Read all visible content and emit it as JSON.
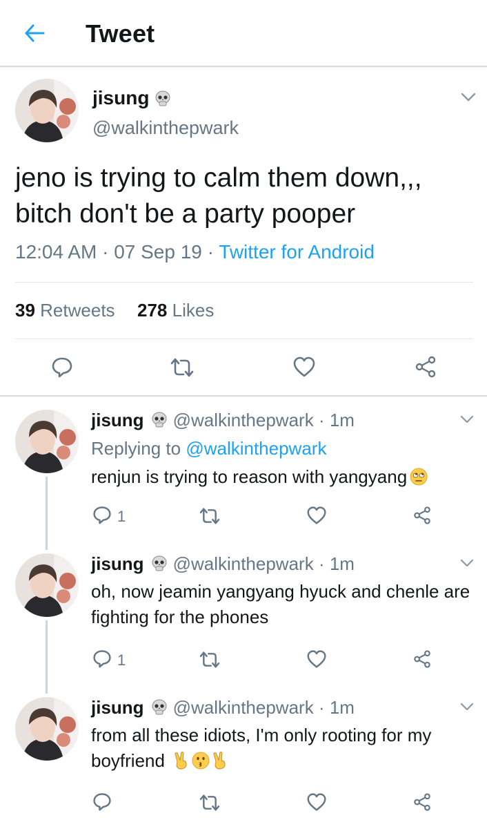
{
  "header": {
    "title": "Tweet"
  },
  "main_tweet": {
    "name": "jisung",
    "handle": "@walkinthepwark",
    "text": "jeno is trying to calm them down,,, bitch don't be a party pooper",
    "time": "12:04 AM",
    "date": "07 Sep 19",
    "source": "Twitter for Android",
    "retweets_count": "39",
    "retweets_label": "Retweets",
    "likes_count": "278",
    "likes_label": "Likes"
  },
  "replies": [
    {
      "name": "jisung",
      "handle": "@walkinthepwark",
      "time": "1m",
      "replying_label": "Replying to",
      "replying_to": "@walkinthepwark",
      "text": "renjun is trying to reason with yangyang",
      "emoji": [
        "face-with-rolling-eyes"
      ],
      "reply_count": "1"
    },
    {
      "name": "jisung",
      "handle": "@walkinthepwark",
      "time": "1m",
      "text": "oh, now jeamin yangyang hyuck and chenle are fighting for the phones",
      "reply_count": "1"
    },
    {
      "name": "jisung",
      "handle": "@walkinthepwark",
      "time": "1m",
      "text": "from all these idiots, I'm only rooting for my boyfriend",
      "emoji": [
        "victory-hand",
        "kissing-face",
        "victory-hand"
      ],
      "reply_count": ""
    }
  ],
  "colors": {
    "accent": "#1da1f2",
    "text": "#14171a",
    "muted": "#657786",
    "divider": "#e1e8ed"
  },
  "icons": [
    "back-arrow-icon",
    "skull-emoji",
    "chevron-down-icon",
    "reply-icon",
    "retweet-icon",
    "like-icon",
    "share-icon"
  ]
}
